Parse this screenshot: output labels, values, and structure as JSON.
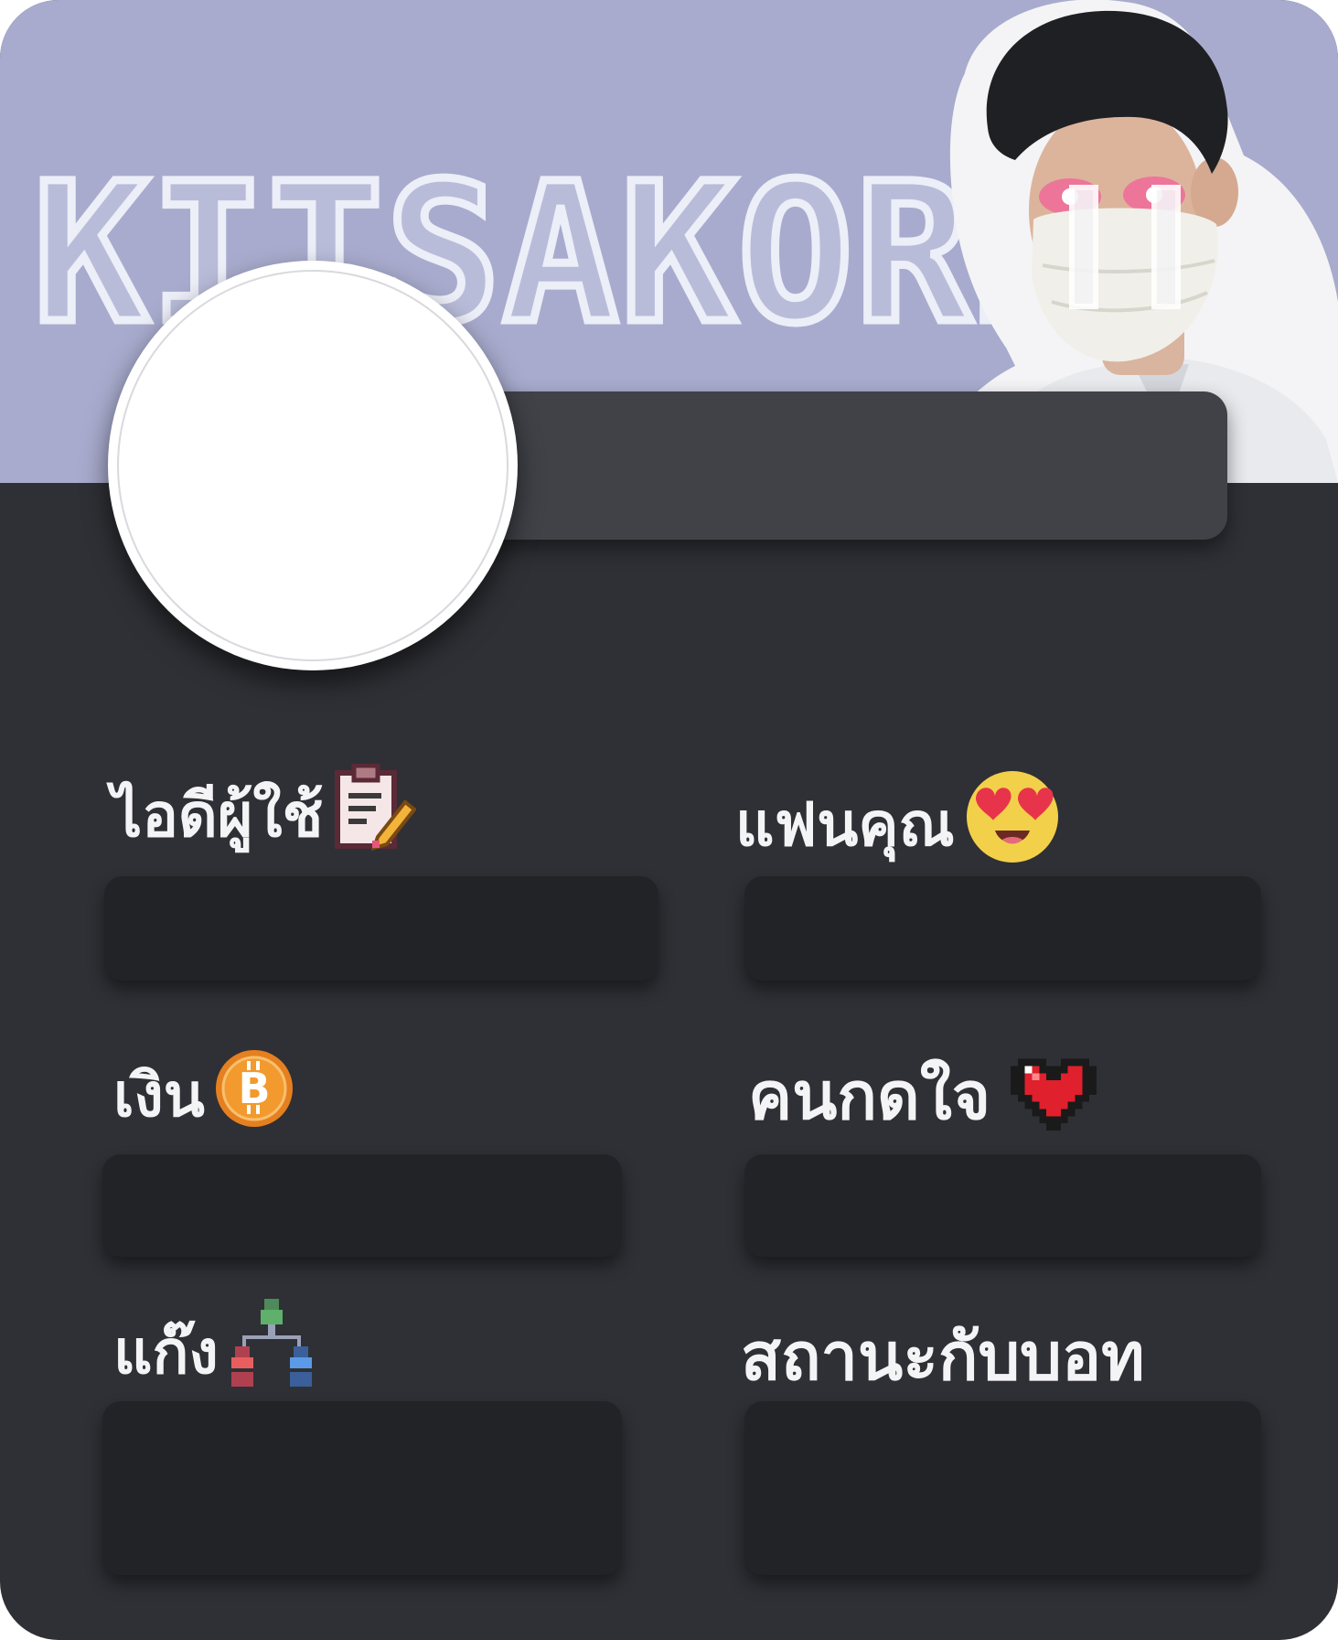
{
  "banner": {
    "title": "KITSAKORN"
  },
  "fields": {
    "user_id": {
      "label": "ไอดีผู้ใช้",
      "icon": "clipboard-pencil-icon"
    },
    "partner": {
      "label": "แฟนคุณ",
      "icon": "heart-eyes-emoji-icon"
    },
    "money": {
      "label": "เงิน",
      "icon": "bitcoin-coin-icon"
    },
    "likes": {
      "label": "คนกดใจ",
      "icon": "pixel-heart-icon"
    },
    "gang": {
      "label": "แก๊ง",
      "icon": "group-people-icon"
    },
    "status": {
      "label": "สถานะกับบอท"
    }
  },
  "colors": {
    "banner": "#a8abcd",
    "panel": "#2f3035",
    "name_bar": "#404248",
    "field_box": "#222327",
    "label_text": "#f4f4f6"
  }
}
